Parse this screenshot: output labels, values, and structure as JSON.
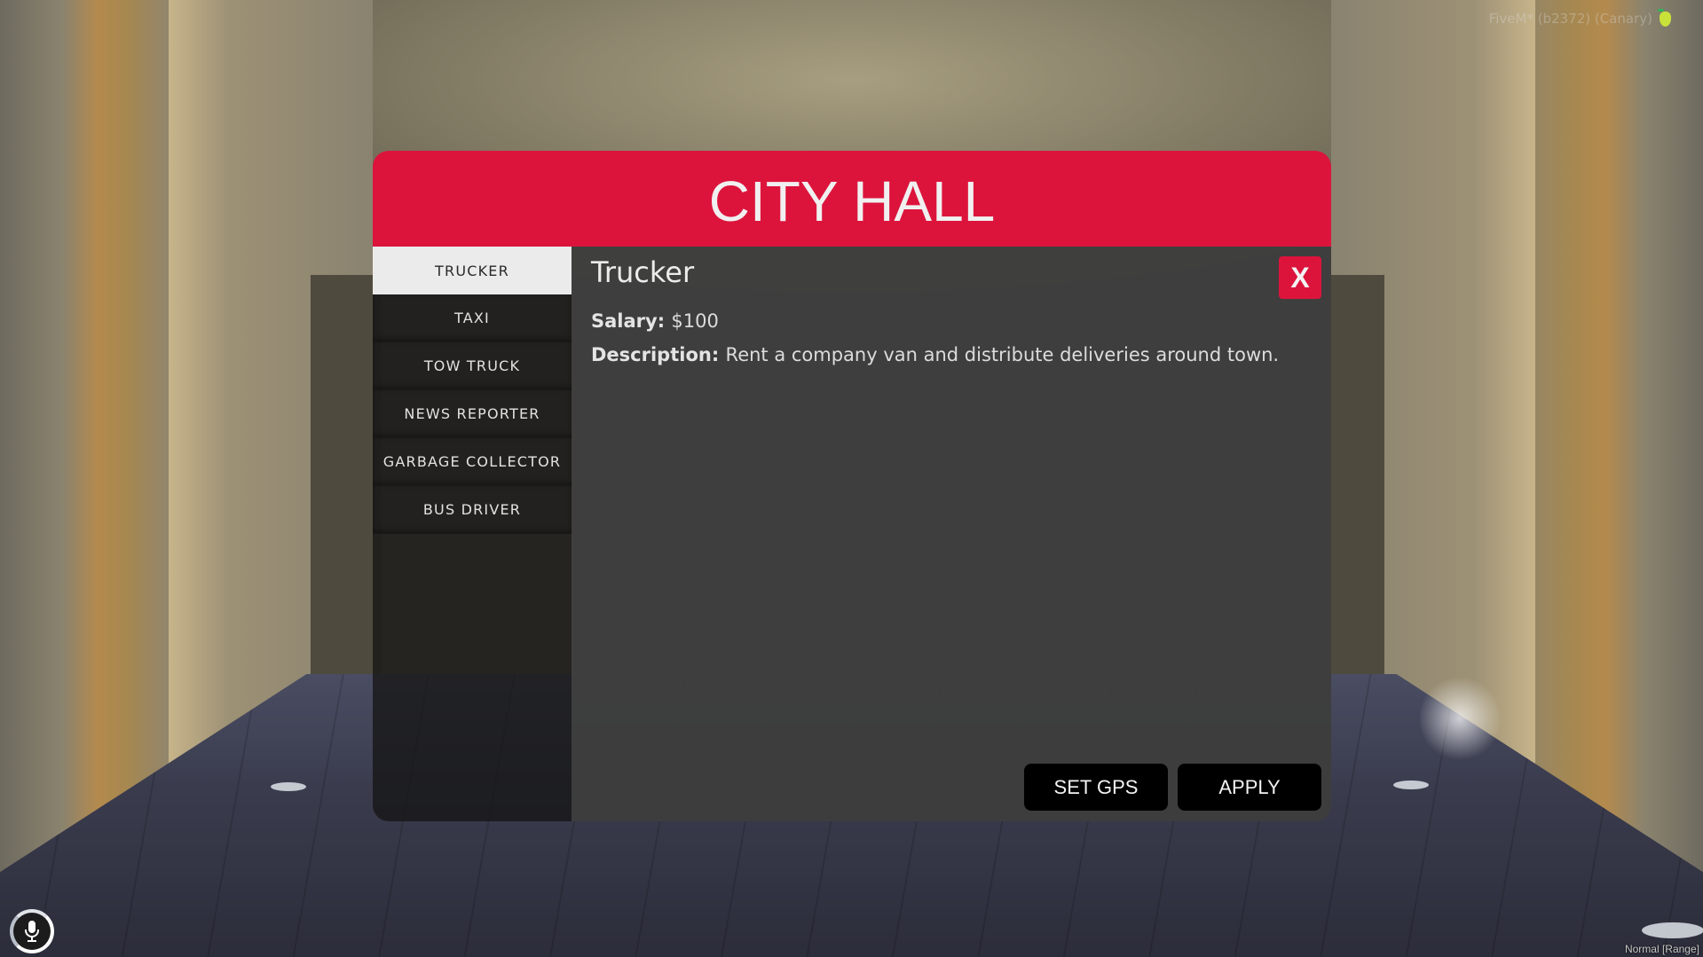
{
  "app": {
    "title": "CITY HALL",
    "accent_color": "#dc143c"
  },
  "sidebar": {
    "items": [
      {
        "label": "TRUCKER",
        "active": true
      },
      {
        "label": "TAXI",
        "active": false
      },
      {
        "label": "TOW TRUCK",
        "active": false
      },
      {
        "label": "NEWS REPORTER",
        "active": false
      },
      {
        "label": "GARBAGE COLLECTOR",
        "active": false
      },
      {
        "label": "BUS DRIVER",
        "active": false
      }
    ]
  },
  "job": {
    "title": "Trucker",
    "salary_label": "Salary:",
    "salary_value": "$100",
    "description_label": "Description:",
    "description_value": "Rent a company van and distribute deliveries around town."
  },
  "buttons": {
    "close": "X",
    "set_gps": "SET GPS",
    "apply": "APPLY"
  },
  "overlay": {
    "watermark": "FiveM* (b2372) (Canary)",
    "watermark_icon": "pear-icon",
    "voice_icon": "microphone-icon",
    "voice_mode": "Normal [Range]"
  }
}
